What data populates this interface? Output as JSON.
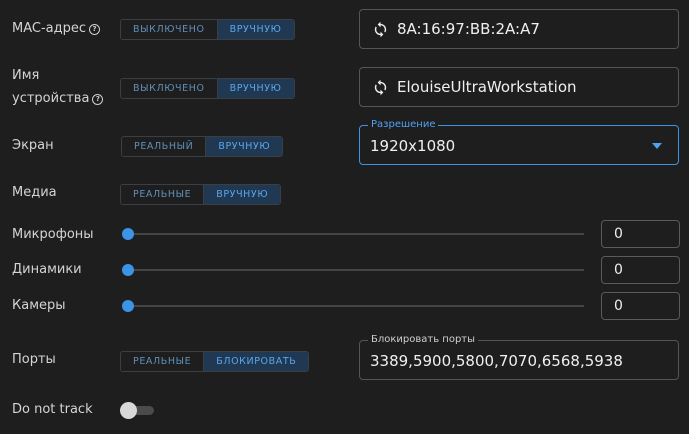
{
  "mac": {
    "label": "MAC-адрес",
    "opt1": "ВЫКЛЮЧЕНО",
    "opt2": "ВРУЧНУЮ",
    "value": "8A:16:97:BB:2A:A7"
  },
  "device": {
    "label1": "Имя",
    "label2": "устройства",
    "opt1": "ВЫКЛЮЧЕНО",
    "opt2": "ВРУЧНУЮ",
    "value": "ElouiseUltraWorkstation"
  },
  "screen": {
    "label": "Экран",
    "opt1": "РЕАЛЬНЫЙ",
    "opt2": "ВРУЧНУЮ",
    "legend": "Разрешение",
    "value": "1920x1080"
  },
  "media": {
    "label": "Медиа",
    "opt1": "РЕАЛЬНЫЕ",
    "opt2": "ВРУЧНУЮ"
  },
  "microphones": {
    "label": "Микрофоны",
    "value": "0",
    "level": 0
  },
  "speakers": {
    "label": "Динамики",
    "value": "0",
    "level": 0
  },
  "cameras": {
    "label": "Камеры",
    "value": "0",
    "level": 0
  },
  "ports": {
    "label": "Порты",
    "opt1": "РЕАЛЬНЫЕ",
    "opt2": "БЛОКИРОВАТЬ",
    "legend": "Блокировать порты",
    "value": "3389,5900,5800,7070,6568,5938"
  },
  "dnt": {
    "label": "Do not track",
    "enabled": false
  },
  "icons": {
    "help": "help-circle-icon",
    "refresh": "refresh-icon",
    "dropdown": "caret-down-icon"
  },
  "colors": {
    "accent": "#3d94e6",
    "selected_bg": "#203851",
    "background": "#1e1e1f"
  }
}
